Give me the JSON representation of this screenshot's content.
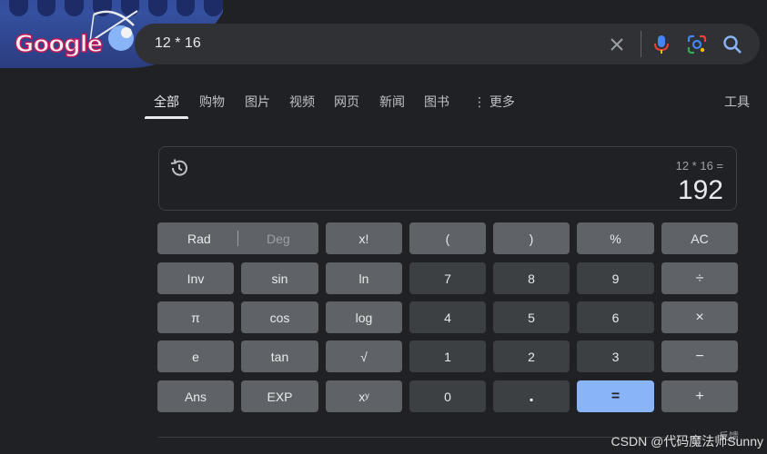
{
  "doodle": {
    "logo_text": "Google"
  },
  "search": {
    "query": "12 * 16"
  },
  "tabs": [
    {
      "label": "全部"
    },
    {
      "label": "购物"
    },
    {
      "label": "图片"
    },
    {
      "label": "视频"
    },
    {
      "label": "网页"
    },
    {
      "label": "新闻"
    },
    {
      "label": "图书"
    },
    {
      "label": "⋮ 更多"
    }
  ],
  "tools_label": "工具",
  "calculator": {
    "expression": "12 * 16 =",
    "result": "192",
    "rad_label": "Rad",
    "deg_label": "Deg",
    "keys": {
      "fact": "x!",
      "lparen": "(",
      "rparen": ")",
      "percent": "%",
      "ac": "AC",
      "inv": "Inv",
      "sin": "sin",
      "ln": "ln",
      "seven": "7",
      "eight": "8",
      "nine": "9",
      "divide": "÷",
      "pi": "π",
      "cos": "cos",
      "log": "log",
      "four": "4",
      "five": "5",
      "six": "6",
      "multiply": "×",
      "e": "e",
      "tan": "tan",
      "sqrt": "√",
      "one": "1",
      "two": "2",
      "three": "3",
      "minus": "−",
      "ans": "Ans",
      "exp": "EXP",
      "pow": "xʸ",
      "zero": "0",
      "dot": ".",
      "equals": "=",
      "plus": "+"
    }
  },
  "feedback_label": "反馈",
  "watermark": "CSDN @代码魔法师Sunny"
}
